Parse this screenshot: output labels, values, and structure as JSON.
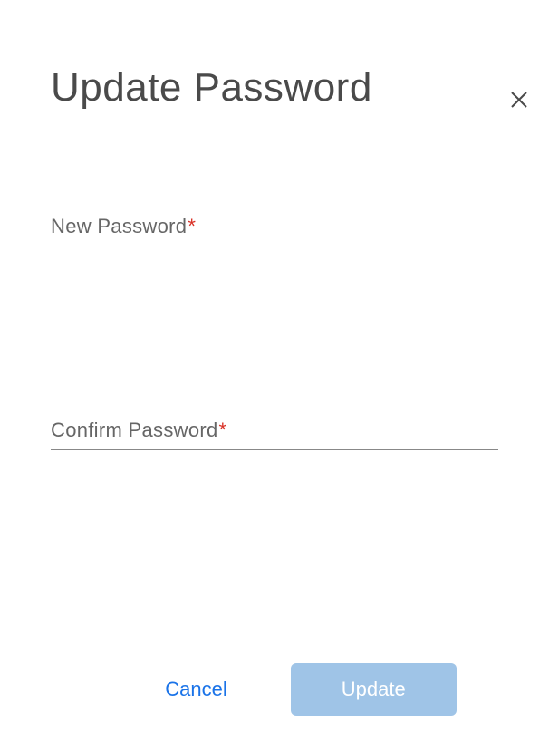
{
  "dialog": {
    "title": "Update Password",
    "fields": {
      "new_password": {
        "label": "New Password",
        "required_mark": "*",
        "value": ""
      },
      "confirm_password": {
        "label": "Confirm Password",
        "required_mark": "*",
        "value": ""
      }
    },
    "buttons": {
      "cancel": "Cancel",
      "update": "Update"
    }
  }
}
